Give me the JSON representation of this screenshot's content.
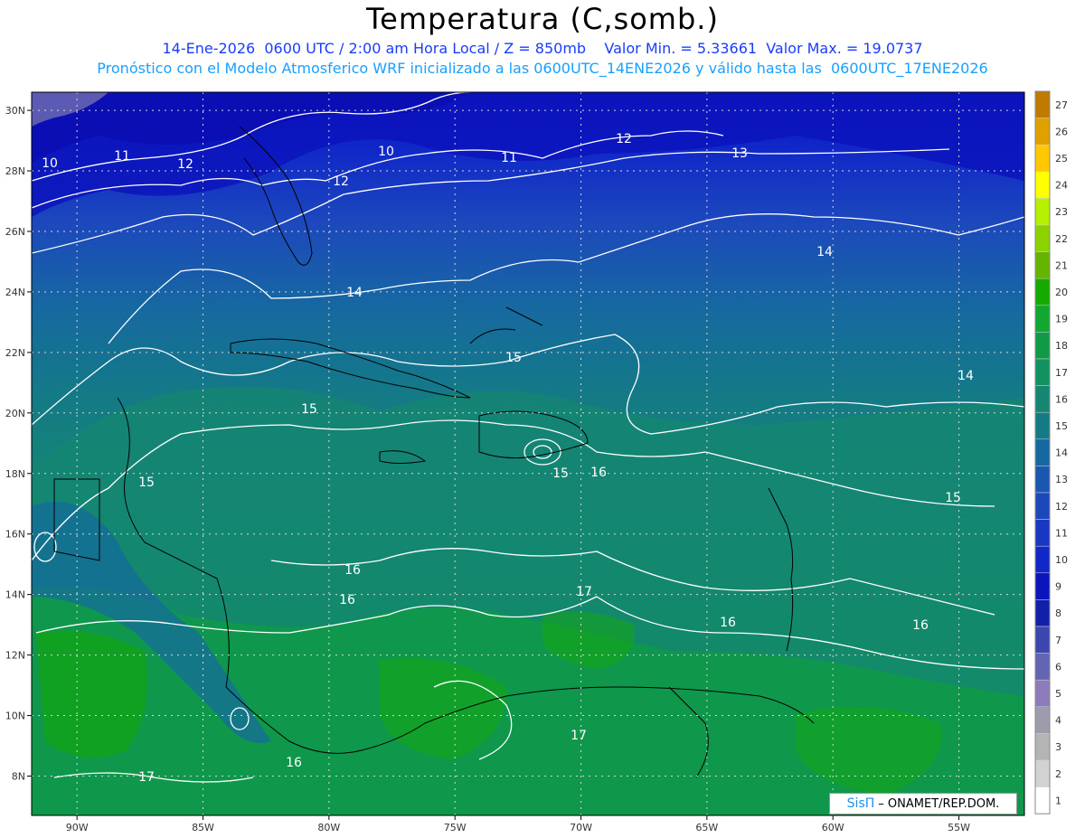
{
  "header": {
    "title": "Temperatura (C,somb.)",
    "subtitle_1": "14-Ene-2026  0600 UTC / 2:00 am Hora Local / Z = 850mb    Valor Min. = 5.33661  Valor Max. = 19.0737",
    "subtitle_2": "Pronóstico con el Modelo Atmosferico WRF inicializado a las 0600UTC_14ENE2026 y válido hasta las  0600UTC_17ENE2026"
  },
  "map": {
    "lat_labels": [
      "30N",
      "28N",
      "26N",
      "24N",
      "22N",
      "20N",
      "18N",
      "16N",
      "14N",
      "12N",
      "10N",
      "8N"
    ],
    "lon_labels": [
      "90W",
      "85W",
      "80W",
      "75W",
      "70W",
      "65W",
      "60W",
      "55W"
    ],
    "contour_labels": [
      "10",
      "11",
      "12",
      "10",
      "11",
      "12",
      "12",
      "13",
      "14",
      "14",
      "15",
      "15",
      "14",
      "15",
      "15",
      "16",
      "16",
      "16",
      "17",
      "16",
      "15",
      "16",
      "17",
      "16",
      "17"
    ]
  },
  "colorbar": {
    "levels": [
      "27",
      "26",
      "25",
      "24",
      "23",
      "22",
      "21",
      "20",
      "19",
      "18",
      "17",
      "16",
      "15",
      "14",
      "13",
      "12",
      "11",
      "10",
      "9",
      "8",
      "7",
      "6",
      "5",
      "4",
      "3",
      "2",
      "1"
    ],
    "colors": [
      "#c07a00",
      "#e0a000",
      "#ffc800",
      "#ffff00",
      "#b4f000",
      "#8cd200",
      "#64b400",
      "#14aa00",
      "#10a830",
      "#0f9a48",
      "#12925e",
      "#148672",
      "#147a86",
      "#1669a0",
      "#1a57b0",
      "#1c48bc",
      "#1838c4",
      "#1028c8",
      "#0c14bc",
      "#1020a8",
      "#3c48b0",
      "#6464b4",
      "#8c7cbc",
      "#9c9cac",
      "#b4b4b4",
      "#d2d2d2",
      "#ffffff"
    ]
  },
  "logo": {
    "brand": "SisΠ",
    "credit": "– ONAMET/REP.DOM."
  }
}
